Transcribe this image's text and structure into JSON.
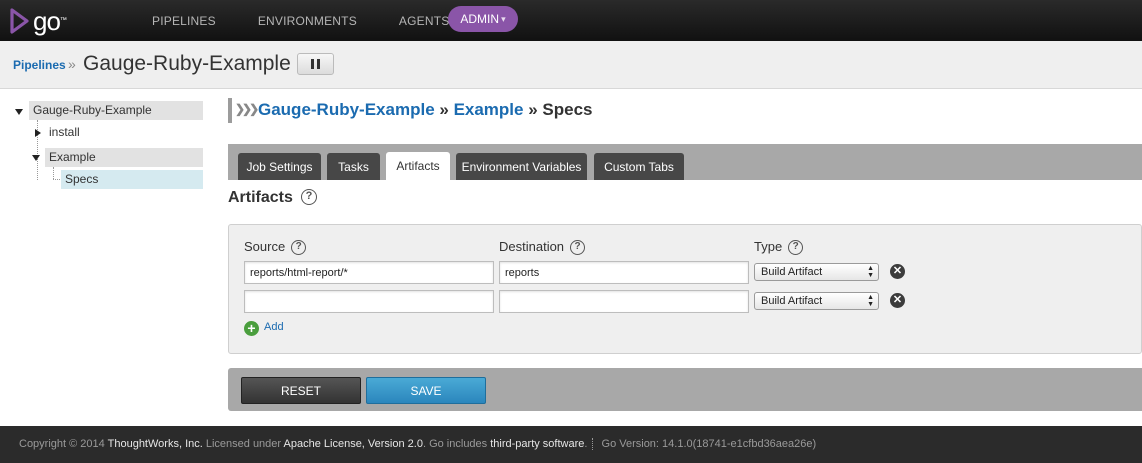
{
  "header": {
    "logo_text": "go",
    "logo_tm": "™",
    "nav": [
      "PIPELINES",
      "ENVIRONMENTS",
      "AGENTS"
    ],
    "admin_label": "ADMIN",
    "admin_caret": "▾"
  },
  "breadcrumb": {
    "pipelines_link": "Pipelines",
    "separator": "»",
    "title": "Gauge-Ruby-Example"
  },
  "tree": {
    "pipeline": "Gauge-Ruby-Example",
    "stage_install": "install",
    "stage_example": "Example",
    "job_specs": "Specs"
  },
  "page_head": {
    "chevrons": "❯❯❯",
    "pipeline": "Gauge-Ruby-Example",
    "sep1": " » ",
    "stage": "Example",
    "sep2": " » ",
    "job": "Specs"
  },
  "tabs": [
    "Job Settings",
    "Tasks",
    "Artifacts",
    "Environment Variables",
    "Custom Tabs"
  ],
  "active_tab": "Artifacts",
  "section": {
    "title": "Artifacts",
    "help": "?"
  },
  "artifacts": {
    "col_source": "Source",
    "col_destination": "Destination",
    "col_type": "Type",
    "help": "?",
    "rows": [
      {
        "source": "reports/html-report/*",
        "destination": "reports",
        "type": "Build Artifact"
      },
      {
        "source": "",
        "destination": "",
        "type": "Build Artifact"
      }
    ],
    "add_label": "Add",
    "add_icon": "+",
    "remove_icon": "✕",
    "select_arrows": "▲▼"
  },
  "actions": {
    "reset": "RESET",
    "save": "SAVE"
  },
  "footer": {
    "copyright": "Copyright © 2014 ",
    "company": "ThoughtWorks, Inc.",
    "licensed": " Licensed under ",
    "license": "Apache License, Version 2.0",
    "includes": ". Go includes ",
    "third_party": "third-party software",
    "period": ".",
    "version": " Go Version: 14.1.0(18741-e1cfbd36aea26e)"
  },
  "colors": {
    "accent_link": "#1b6bb0",
    "admin_purple": "#8a55a8",
    "save_blue": "#2b86bd",
    "add_green": "#4a9e3d"
  }
}
